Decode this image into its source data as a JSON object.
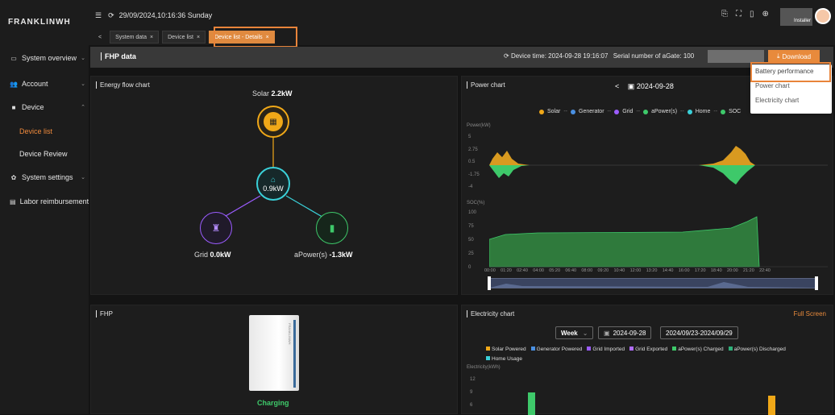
{
  "app": {
    "logo": "FRANKLINWH",
    "datetime": "29/09/2024,10:16:36 Sunday",
    "user": "Installer"
  },
  "sidebar": {
    "items": [
      {
        "label": "System overview",
        "icon": "monitor-icon"
      },
      {
        "label": "Account",
        "icon": "users-icon"
      },
      {
        "label": "Device",
        "icon": "device-icon"
      },
      {
        "label": "Device list"
      },
      {
        "label": "Device Review"
      },
      {
        "label": "System settings",
        "icon": "gear-icon"
      },
      {
        "label": "Labor reimbursement",
        "icon": "receipt-icon"
      }
    ]
  },
  "tabs": [
    {
      "label": "System data"
    },
    {
      "label": "Device list"
    },
    {
      "label": "Device list - Details"
    }
  ],
  "fhp_bar": {
    "title": "FHP data",
    "device_time": "Device time: 2024-09-28 19:16:07",
    "serial": "Serial number of aGate: 100",
    "download": "Download"
  },
  "download_menu": {
    "items": [
      "Battery performance",
      "Power chart",
      "Electricity chart"
    ]
  },
  "energy_flow": {
    "title": "Energy flow chart",
    "solar_label": "Solar",
    "solar_value": "2.2kW",
    "center_value": "0.9kW",
    "grid_label": "Grid",
    "grid_value": "0.0kW",
    "apower_label": "aPower(s)",
    "apower_value": "-1.3kW",
    "colors": {
      "solar": "#f0a818",
      "center": "#3ad0d8",
      "grid": "#9b5cff",
      "apower": "#3ec96a"
    }
  },
  "power_chart": {
    "title": "Power chart",
    "date": "2024-09-28",
    "legend": [
      "Solar",
      "Generator",
      "Grid",
      "aPower(s)",
      "Home",
      "SOC"
    ],
    "power_axis_title": "Power(kW)",
    "power_ticks": [
      "5",
      "2.75",
      "0.5",
      "-1.75",
      "-4"
    ],
    "soc_axis_title": "SOC(%)",
    "soc_ticks": [
      "100",
      "75",
      "50",
      "25",
      "0"
    ],
    "x_ticks": [
      "00:00",
      "01:20",
      "02:40",
      "04:00",
      "05:20",
      "06:40",
      "08:00",
      "09:20",
      "10:40",
      "12:00",
      "13:20",
      "14:40",
      "16:00",
      "17:20",
      "18:40",
      "20:00",
      "21:20",
      "22:40"
    ]
  },
  "fhp": {
    "title": "FHP",
    "status": "Charging",
    "brand": "FRANKLINWH"
  },
  "electricity_chart": {
    "title": "Electricity chart",
    "full_screen": "Full Screen",
    "period": "Week",
    "date": "2024-09-28",
    "range": "2024/09/23-2024/09/29",
    "legend": [
      "Solar Powered",
      "Generator Powered",
      "Grid Imported",
      "Grid Exported",
      "aPower(s) Charged",
      "aPower(s) Discharged",
      "Home Usage"
    ],
    "axis_title": "Electricity(kWh)",
    "ticks": [
      "12",
      "9",
      "6"
    ]
  }
}
